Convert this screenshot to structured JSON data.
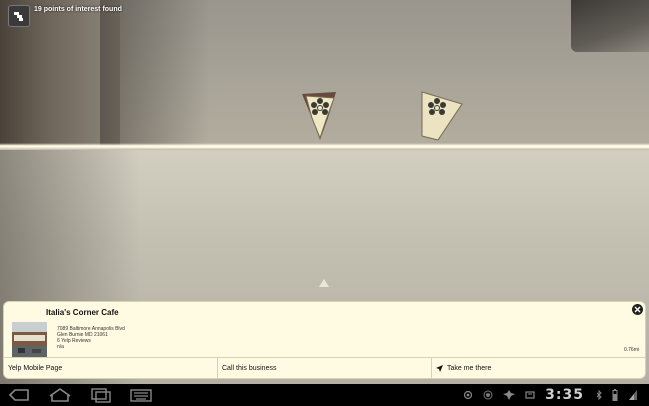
{
  "header": {
    "poi_count_text": "19 points of interest found",
    "menu_icon": "layers-icon"
  },
  "markers": [
    {
      "name": "yelp-marker",
      "icon": "yelp-burst-icon"
    },
    {
      "name": "yelp-marker",
      "icon": "yelp-burst-icon"
    }
  ],
  "card": {
    "title": "Italia's Corner Cafe",
    "address_line1": "7089 Baltimore Annapolis Blvd",
    "address_line2": "Glen Burnie MD 21061",
    "reviews": "6 Yelp Reviews",
    "extra": "n/a",
    "distance": "0.76mi",
    "actions": [
      {
        "label": "Yelp Mobile Page"
      },
      {
        "label": "Call this business"
      },
      {
        "label": "Take me there",
        "icon": "navigation-arrow-icon"
      }
    ]
  },
  "system_bar": {
    "clock": "3:35",
    "colors": {
      "clock": "#cfcfcf",
      "bar": "#000000"
    }
  }
}
